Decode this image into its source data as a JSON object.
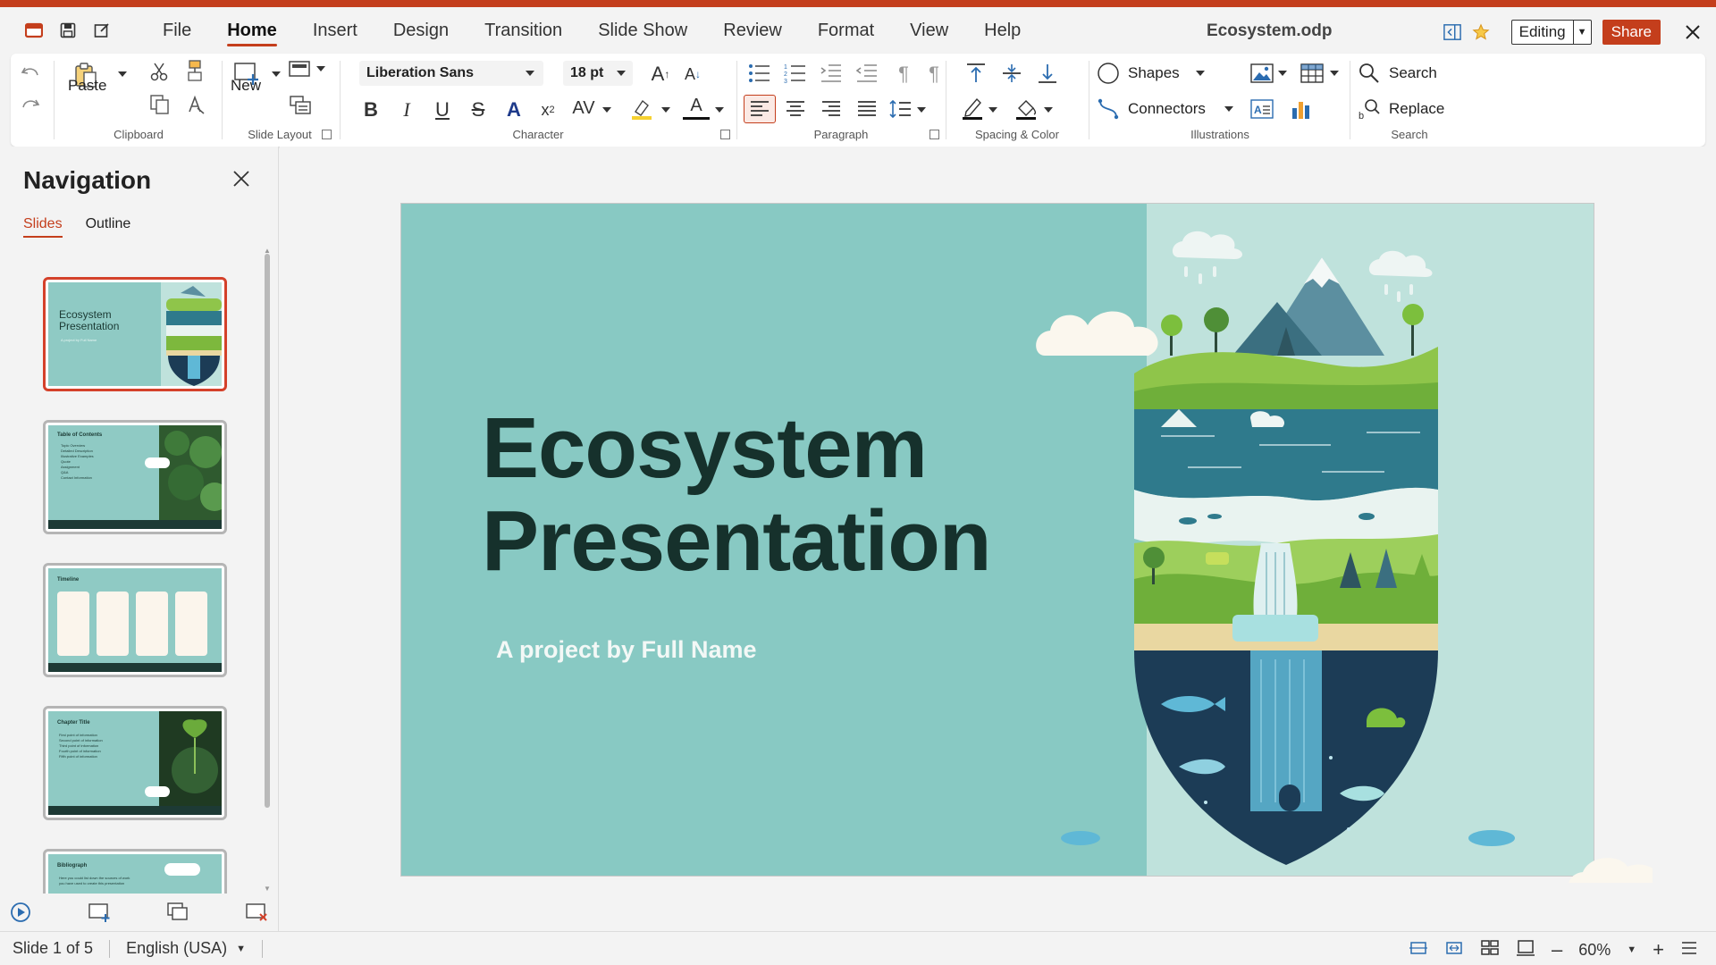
{
  "app": {
    "document_title": "Ecosystem.odp",
    "editing_label": "Editing",
    "share_label": "Share",
    "accent_color": "#c43e1c"
  },
  "menu": {
    "items": [
      "File",
      "Home",
      "Insert",
      "Design",
      "Transition",
      "Slide Show",
      "Review",
      "Format",
      "View",
      "Help"
    ],
    "active": "Home"
  },
  "ribbon": {
    "clipboard": {
      "paste_label": "Paste",
      "group_label": "Clipboard"
    },
    "slide_layout": {
      "new_label": "New",
      "group_label": "Slide Layout"
    },
    "character": {
      "font_name": "Liberation Sans",
      "font_size": "18 pt",
      "group_label": "Character"
    },
    "paragraph": {
      "group_label": "Paragraph"
    },
    "spacing": {
      "group_label": "Spacing & Color"
    },
    "illustrations": {
      "shapes_label": "Shapes",
      "connectors_label": "Connectors",
      "group_label": "Illustrations"
    },
    "search": {
      "search_label": "Search",
      "replace_label": "Replace",
      "group_label": "Search"
    }
  },
  "navigation": {
    "title": "Navigation",
    "tabs": [
      "Slides",
      "Outline"
    ],
    "active_tab": "Slides",
    "slides": [
      {
        "title": "Ecosystem Presentation",
        "subtitle": "A project by Full Name"
      },
      {
        "title": "Table of Contents",
        "items": [
          "Topic Overview",
          "Detailed Description",
          "Illustrative Examples",
          "Quote",
          "Assignment",
          "Q&A",
          "Contact Information"
        ]
      },
      {
        "title": "Timeline"
      },
      {
        "title": "Chapter Title",
        "items": [
          "First point of information",
          "Second point of information",
          "Third point of information",
          "Fourth point of information",
          "Fifth point of information"
        ]
      },
      {
        "title": "Bibliograph",
        "body": "Here you could list down the sources of work you have used to create this presentation"
      }
    ]
  },
  "slide": {
    "title": "Ecosystem\nPresentation",
    "subtitle": "A project by Full Name",
    "background_color": "#88c9c3",
    "title_color": "#16312c"
  },
  "status": {
    "slide_indicator": "Slide 1 of 5",
    "language": "English (USA)",
    "zoom": "60%"
  }
}
